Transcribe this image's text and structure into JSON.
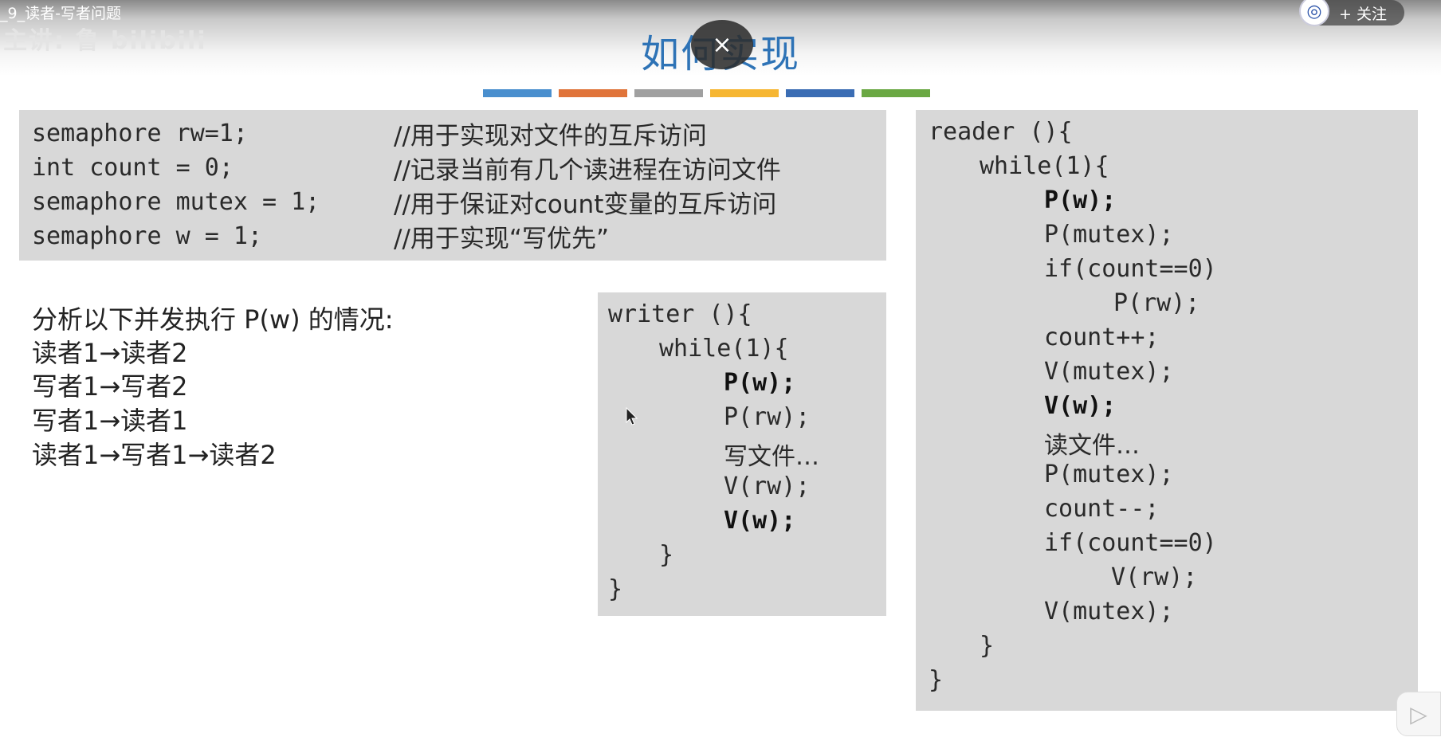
{
  "video": {
    "title": "_9_读者-写者问题",
    "watermark": "主讲: 鲁 bilibili",
    "follow_label": "+ 关注",
    "avatar_icon": "university-logo-icon"
  },
  "slide": {
    "title": "如何实现",
    "close_icon": "×",
    "color_bar": [
      "#4a8fce",
      "#e0743a",
      "#a0a0a0",
      "#f6b632",
      "#3b6db4",
      "#6aa843"
    ]
  },
  "declarations": [
    {
      "code": "semaphore rw=1;",
      "comment": "//用于实现对文件的互斥访问"
    },
    {
      "code": "int count = 0;",
      "comment": "//记录当前有几个读进程在访问文件"
    },
    {
      "code": "semaphore mutex = 1;",
      "comment": "//用于保证对count变量的互斥访问"
    },
    {
      "code": "semaphore w = 1;",
      "comment": "//用于实现“写优先”"
    }
  ],
  "analysis": {
    "heading": "分析以下并发执行 P(w) 的情况:",
    "cases": [
      "读者1→读者2",
      "写者1→写者2",
      "写者1→读者1",
      "读者1→写者1→读者2"
    ]
  },
  "writer": {
    "lines": [
      "writer (){",
      "while(1){",
      "P(w);",
      "P(rw);",
      "写文件…",
      "V(rw);",
      "V(w);",
      "}",
      "}"
    ]
  },
  "reader": {
    "lines": [
      "reader (){",
      "while(1){",
      "P(w);",
      "P(mutex);",
      "if(count==0)",
      "P(rw);",
      "count++;",
      "V(mutex);",
      "V(w);",
      "读文件…",
      "P(mutex);",
      "count--;",
      "if(count==0)",
      "V(rw);",
      "V(mutex);",
      "}",
      "}"
    ]
  },
  "player": {
    "play_icon": "▷"
  }
}
